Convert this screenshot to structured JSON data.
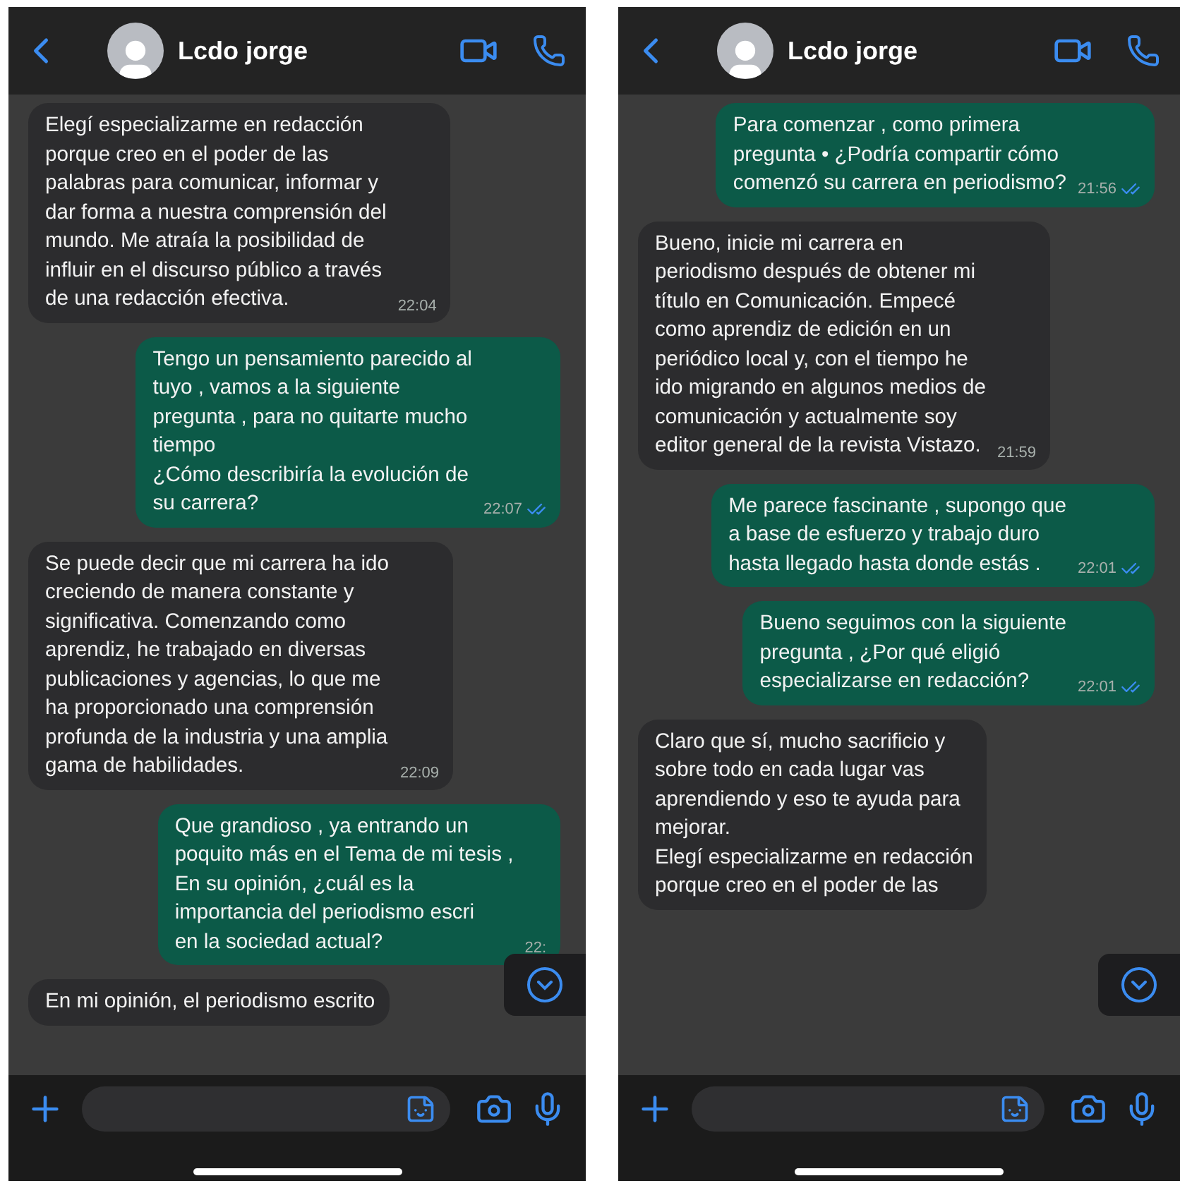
{
  "phones": [
    {
      "contact": {
        "name": "Lcdo jorge"
      },
      "messages": [
        {
          "kind": "incoming",
          "text": "Elegí especializarme en redacción\nporque creo en el poder de las\npalabras para comunicar, informar y\ndar forma a nuestra comprensión del\nmundo. Me atraía la posibilidad de\ninfluir en el discurso público a través\nde una redacción efectiva.",
          "time": "22:04"
        },
        {
          "kind": "outgoing",
          "text": "Tengo un pensamiento parecido al\ntuyo , vamos a la siguiente\npregunta , para no quitarte mucho\ntiempo\n ¿Cómo describiría la evolución de\nsu carrera?",
          "time": "22:07",
          "read": true
        },
        {
          "kind": "incoming",
          "text": "Se puede decir que mi carrera ha ido\ncreciendo de manera constante y\nsignificativa. Comenzando como\naprendiz, he trabajado en diversas\npublicaciones y agencias, lo que me\nha proporcionado una comprensión\nprofunda de la industria y una amplia\ngama de habilidades.",
          "time": "22:09"
        },
        {
          "kind": "outgoing",
          "text": "Que grandioso , ya entrando un\npoquito más en el Tema de mi tesis ,\nEn su opinión, ¿cuál es la\nimportancia del periodismo escri\nen la sociedad actual?",
          "time": "22:",
          "read": false
        },
        {
          "kind": "incoming",
          "text": "En mi opinión, el periodismo escrito"
        }
      ]
    },
    {
      "contact": {
        "name": "Lcdo jorge"
      },
      "messages": [
        {
          "kind": "outgoing",
          "text": "Para comenzar , como primera\npregunta • ¿Podría compartir cómo\ncomenzó su carrera en periodismo?",
          "time": "21:56",
          "read": true
        },
        {
          "kind": "incoming",
          "text": "Bueno, inicie mi carrera en\nperiodismo después de obtener mi\ntítulo en Comunicación. Empecé\ncomo aprendiz de edición en un\nperiódico local y, con el tiempo he\nido migrando en algunos medios de\ncomunicación y actualmente soy\neditor general de la revista Vistazo.",
          "time": "21:59"
        },
        {
          "kind": "outgoing",
          "text": "Me parece fascinante , supongo que\na base de esfuerzo y trabajo duro\nhasta llegado hasta donde estás .",
          "time": "22:01",
          "read": true
        },
        {
          "kind": "outgoing",
          "text": "Bueno seguimos con la siguiente\npregunta , ¿Por qué eligió\nespecializarse en redacción?",
          "time": "22:01",
          "read": true
        },
        {
          "kind": "incoming",
          "text": "Claro que sí, mucho sacrificio y\nsobre todo  en cada lugar vas\naprendiendo y eso te ayuda para\nmejorar.\nElegí especializarme en redacción\nporque creo en el poder de las"
        }
      ]
    }
  ]
}
